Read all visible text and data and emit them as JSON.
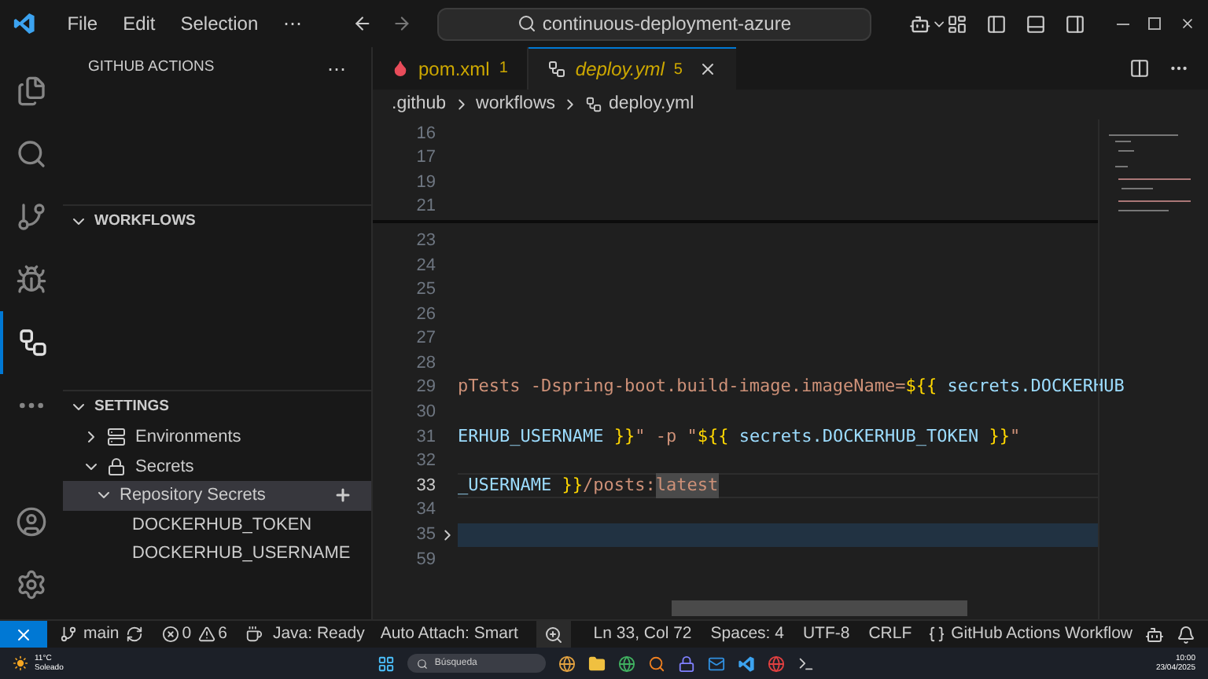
{
  "title_bar": {
    "menus": [
      "File",
      "Edit",
      "Selection"
    ],
    "more": "⋯",
    "search": "continuous-deployment-azure"
  },
  "sidebar": {
    "title": "GITHUB ACTIONS",
    "more": "⋯",
    "sections": [
      {
        "title": "WORKFLOWS",
        "expanded": true
      },
      {
        "title": "SETTINGS",
        "expanded": true,
        "items": [
          {
            "label": "Environments",
            "kind": "environment",
            "expanded": false,
            "selected": false
          },
          {
            "label": "Secrets",
            "kind": "secrets",
            "expanded": true,
            "selected": false,
            "children": [
              {
                "label": "Repository Secrets",
                "addable": true,
                "expanded": true,
                "selected": true,
                "children": [
                  {
                    "label": "DOCKERHUB_TOKEN",
                    "selected": false
                  },
                  {
                    "label": "DOCKERHUB_USERNAME",
                    "selected": false
                  }
                ]
              }
            ]
          }
        ]
      }
    ]
  },
  "tabs": [
    {
      "label": "pom.xml",
      "badge": "1",
      "kind": "xml",
      "selected": false,
      "preview": false
    },
    {
      "label": "deploy.yml",
      "badge": "5",
      "kind": "workflow",
      "selected": true,
      "preview": true
    }
  ],
  "breadcrumb": [
    ".github",
    "workflows",
    "deploy.yml"
  ],
  "sticky_lines": [
    {
      "number": "16"
    },
    {
      "number": "17"
    },
    {
      "number": "19"
    },
    {
      "number": "21"
    }
  ],
  "lines": [
    {
      "number": "23"
    },
    {
      "number": "24"
    },
    {
      "number": "25"
    },
    {
      "number": "26"
    },
    {
      "number": "27"
    },
    {
      "number": "28"
    },
    {
      "number": "29",
      "tokens": [
        {
          "text": "pTests -Dspring-boot.build-image.imageName=",
          "kind": "string"
        },
        {
          "text": "${{",
          "kind": "brace"
        },
        {
          "text": " secrets.DOCKERHUB",
          "kind": "variable"
        }
      ]
    },
    {
      "number": "30"
    },
    {
      "number": "31",
      "tokens": [
        {
          "text": "ERHUB_USERNAME",
          "kind": "variable"
        },
        {
          "text": " }}",
          "kind": "brace"
        },
        {
          "text": "\" -p \"",
          "kind": "string"
        },
        {
          "text": "${{",
          "kind": "brace"
        },
        {
          "text": " secrets.DOCKERHUB_TOKEN",
          "kind": "variable"
        },
        {
          "text": " }}",
          "kind": "brace"
        },
        {
          "text": "\"",
          "kind": "string"
        }
      ]
    },
    {
      "number": "32"
    },
    {
      "number": "33",
      "current": true,
      "tokens": [
        {
          "text": "_USERNAME",
          "kind": "variable"
        },
        {
          "text": " }}",
          "kind": "brace"
        },
        {
          "text": "/posts:",
          "kind": "string"
        },
        {
          "text": "latest",
          "kind": "highlight"
        }
      ]
    },
    {
      "number": "34"
    },
    {
      "number": "35",
      "folded": true
    },
    {
      "number": "59"
    }
  ],
  "status_bar": {
    "branch": "main",
    "errors": "0",
    "warnings": "6",
    "left": [
      "Java: Ready",
      "Auto Attach: Smart"
    ],
    "right": [
      "Ln 33, Col 72",
      "Spaces: 4",
      "UTF-8",
      "CRLF"
    ],
    "language": "GitHub Actions Workflow"
  },
  "taskbar": {
    "temperature": "11°C",
    "weather": "Soleado",
    "search": "Búsqueda",
    "time": "10:00",
    "date": "23/04/2025"
  }
}
